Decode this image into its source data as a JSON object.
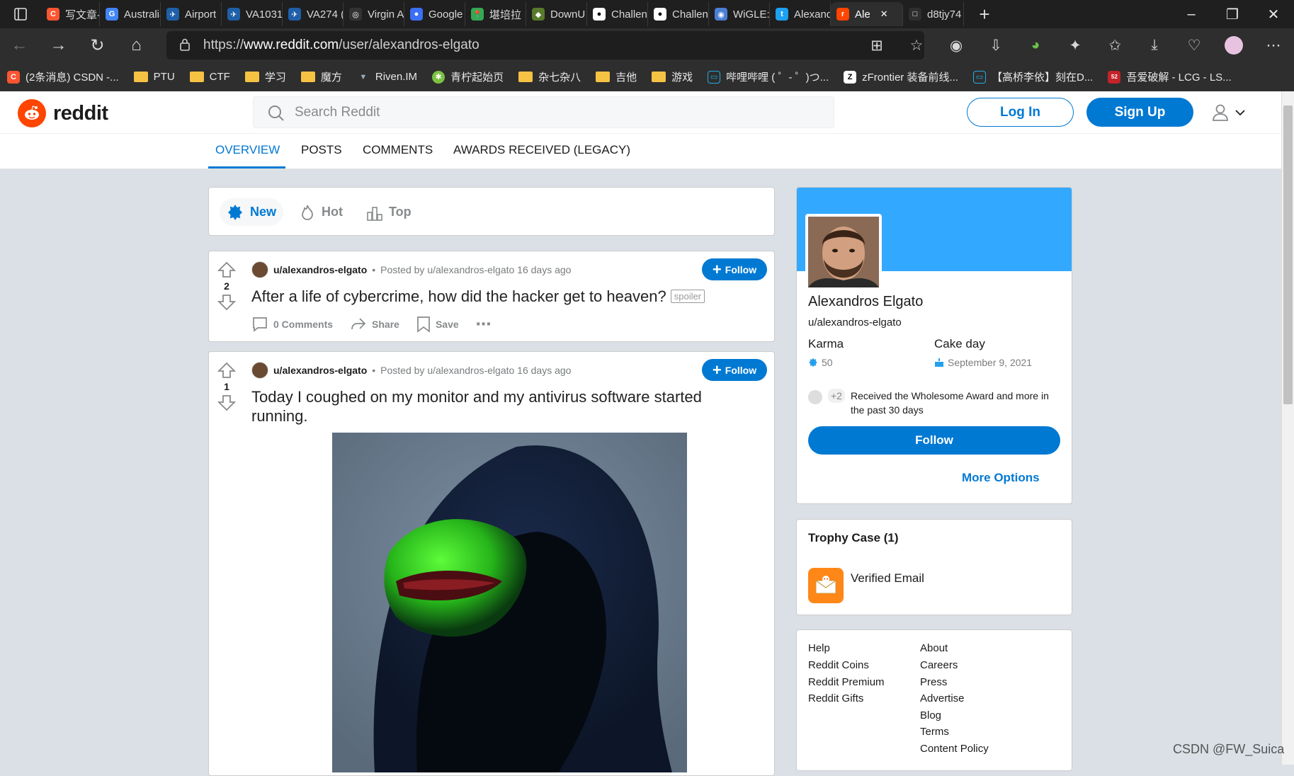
{
  "browser": {
    "tabs": [
      {
        "label": "写文章-",
        "fav": "C",
        "color": "#fc5531"
      },
      {
        "label": "Australia",
        "fav": "G",
        "color": "#4285f4"
      },
      {
        "label": "Airport",
        "fav": "✈",
        "color": "#1f5fa8"
      },
      {
        "label": "VA1031",
        "fav": "✈",
        "color": "#1f5fa8"
      },
      {
        "label": "VA274 (",
        "fav": "✈",
        "color": "#1f5fa8"
      },
      {
        "label": "Virgin A",
        "fav": "◎",
        "color": "#333333"
      },
      {
        "label": "Google",
        "fav": "●",
        "color": "#3b6ff5"
      },
      {
        "label": "堪培拉",
        "fav": "📍",
        "color": "#34a853"
      },
      {
        "label": "DownU",
        "fav": "◆",
        "color": "#577a2b"
      },
      {
        "label": "Challen",
        "fav": "●",
        "color": "#ffffff"
      },
      {
        "label": "Challen",
        "fav": "●",
        "color": "#ffffff"
      },
      {
        "label": "WiGLE:",
        "fav": "◉",
        "color": "#4a7fd4"
      },
      {
        "label": "Alexand",
        "fav": "t",
        "color": "#1da1f2"
      },
      {
        "label": "Ale",
        "fav": "r",
        "color": "#ff4500",
        "active": true
      },
      {
        "label": "d8tjy74",
        "fav": "□",
        "color": "#2e2e2e"
      }
    ],
    "url_prefix": "https://",
    "url_domain": "www.reddit.com",
    "url_path": "/user/alexandros-elgato",
    "bookmarks": [
      {
        "label": "(2条消息) CSDN -...",
        "type": "csdn"
      },
      {
        "label": "PTU",
        "type": "folder"
      },
      {
        "label": "CTF",
        "type": "folder"
      },
      {
        "label": "学习",
        "type": "folder"
      },
      {
        "label": "魔方",
        "type": "folder"
      },
      {
        "label": "Riven.IM",
        "type": "riven"
      },
      {
        "label": "青柠起始页",
        "type": "lime"
      },
      {
        "label": "杂七杂八",
        "type": "folder"
      },
      {
        "label": "吉他",
        "type": "folder"
      },
      {
        "label": "游戏",
        "type": "folder"
      },
      {
        "label": "哔哩哔哩 ( ゜- ゜)つ...",
        "type": "bili"
      },
      {
        "label": "zFrontier 装备前线...",
        "type": "z"
      },
      {
        "label": "【高桥李依】刻在D...",
        "type": "bili"
      },
      {
        "label": "吾爱破解 - LCG - LS...",
        "type": "52"
      }
    ]
  },
  "reddit": {
    "logo_text": "reddit",
    "search_placeholder": "Search Reddit",
    "login": "Log In",
    "signup": "Sign Up",
    "tabs": [
      "OVERVIEW",
      "POSTS",
      "COMMENTS",
      "AWARDS RECEIVED (LEGACY)"
    ],
    "sort": [
      "New",
      "Hot",
      "Top"
    ],
    "posts": [
      {
        "votes": "2",
        "author": "u/alexandros-elgato",
        "meta": "Posted by u/alexandros-elgato 16 days ago",
        "follow": "Follow",
        "title": "After a life of cybercrime, how did the hacker get to heaven?",
        "flair": "spoiler",
        "comments": "0 Comments",
        "share": "Share",
        "save": "Save"
      },
      {
        "votes": "1",
        "author": "u/alexandros-elgato",
        "meta": "Posted by u/alexandros-elgato 16 days ago",
        "follow": "Follow",
        "title": "Today I coughed on my monitor and my antivirus software started running."
      }
    ],
    "profile": {
      "name": "Alexandros Elgato",
      "handle": "u/alexandros-elgato",
      "karma_label": "Karma",
      "karma": "50",
      "cake_label": "Cake day",
      "cake": "September 9, 2021",
      "award_count": "+2",
      "award_text": "Received the Wholesome Award and more in the past 30 days",
      "follow": "Follow",
      "more": "More Options"
    },
    "trophy": {
      "title": "Trophy Case (1)",
      "item": "Verified Email"
    },
    "footer_left": [
      "Help",
      "Reddit Coins",
      "Reddit Premium",
      "Reddit Gifts"
    ],
    "footer_right": [
      "About",
      "Careers",
      "Press",
      "Advertise",
      "Blog",
      "Terms",
      "Content Policy"
    ]
  },
  "watermark": "CSDN @FW_Suica",
  "colors": {
    "reddit_blue": "#0079d3",
    "reddit_orange": "#ff4500",
    "banner": "#33a8ff"
  }
}
